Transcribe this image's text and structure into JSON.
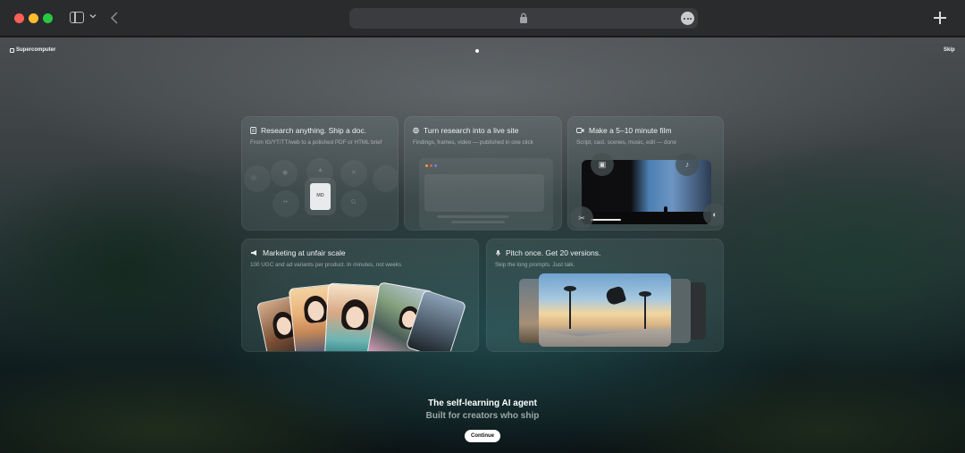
{
  "browser": {
    "url_icon": "lock-icon",
    "menu_icon": "more-icon",
    "new_tab_icon": "plus-icon"
  },
  "header": {
    "brand": "Supercomputer",
    "skip_label": "Skip"
  },
  "cards": [
    {
      "icon": "document-icon",
      "title": "Research anything. Ship a doc.",
      "description": "From IG/YT/TT/web to a polished PDF or HTML brief",
      "badge": "MD"
    },
    {
      "icon": "globe-icon",
      "title": "Turn research into a live site",
      "description": "Findings, frames, video — published in one click"
    },
    {
      "icon": "video-camera-icon",
      "title": "Make a 5–10 minute film",
      "description": "Script, cast, scenes, music, edit — done"
    },
    {
      "icon": "megaphone-icon",
      "title": "Marketing at unfair scale",
      "description": "100 UGC and ad variants per product. In minutes, not weeks"
    },
    {
      "icon": "microphone-icon",
      "title": "Pitch once. Get 20 versions.",
      "description": "Skip the long prompts. Just talk."
    }
  ],
  "hero": {
    "title": "The self-learning AI agent",
    "subtitle": "Built for creators who ship",
    "cta": "Continue"
  },
  "colors": {
    "accent_button": "#ffffff",
    "chrome_bg": "#2a2b2d",
    "traffic_red": "#fe5f57",
    "traffic_yellow": "#febc2e",
    "traffic_green": "#28c840"
  }
}
